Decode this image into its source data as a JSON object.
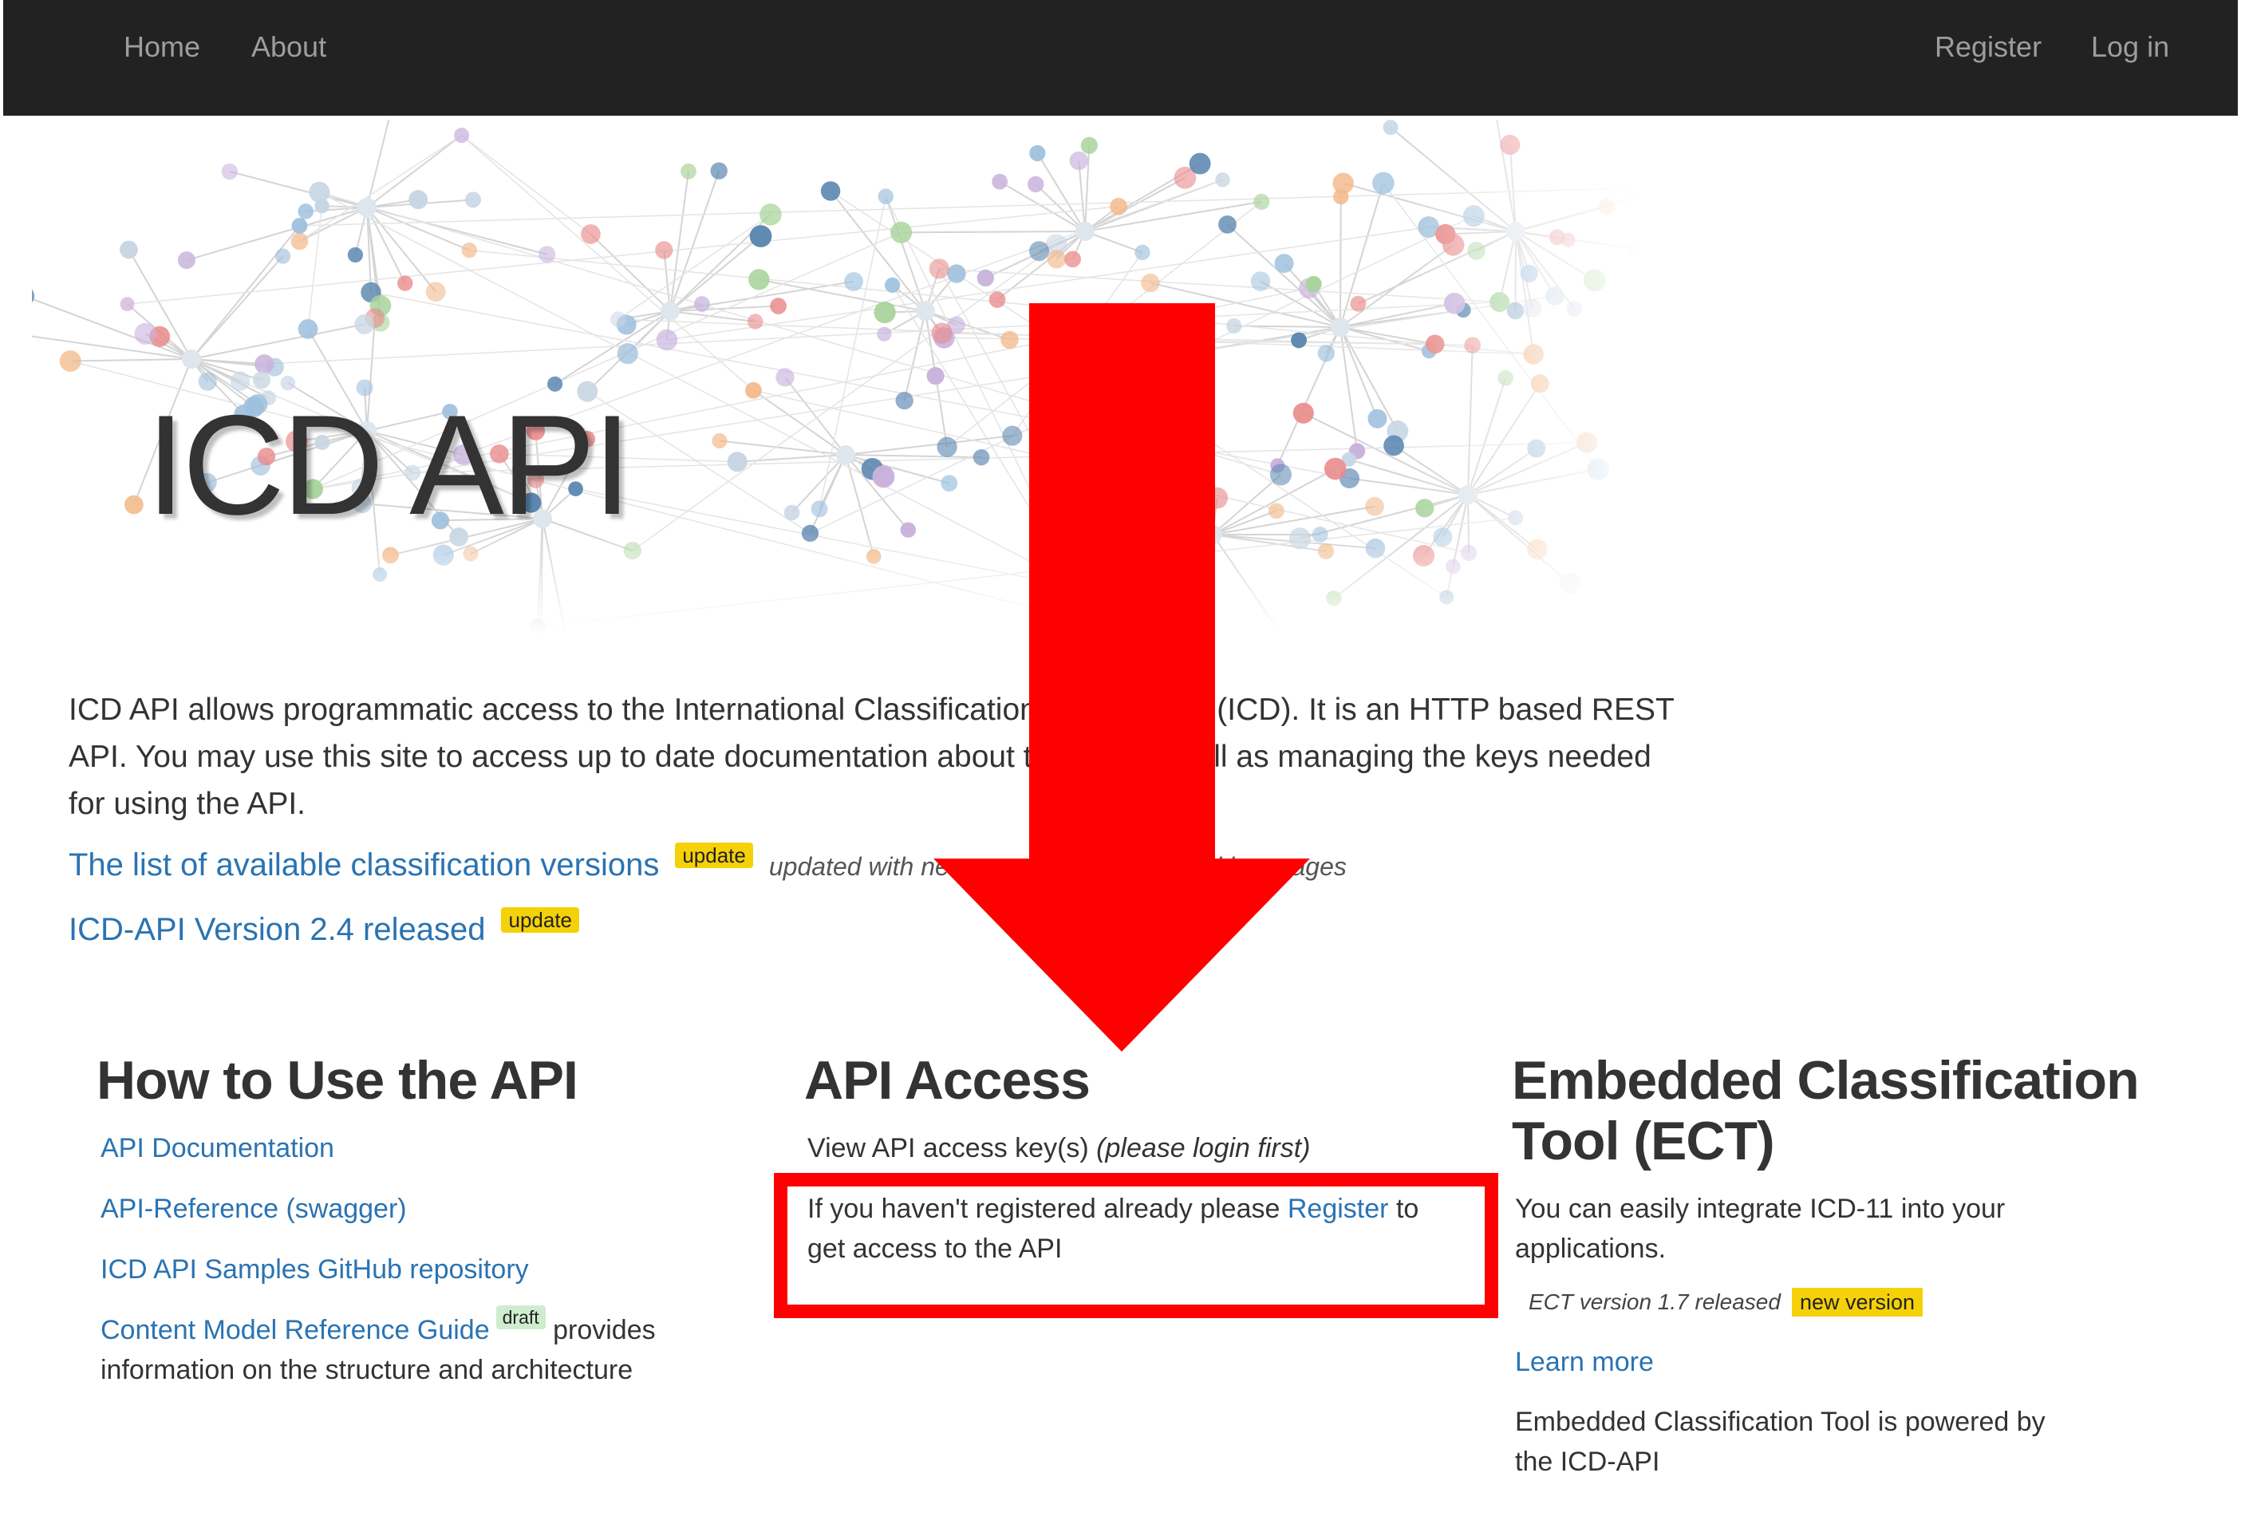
{
  "nav": {
    "home": "Home",
    "about": "About",
    "register": "Register",
    "login": "Log in"
  },
  "hero": {
    "title": "ICD API"
  },
  "intro": {
    "text": "ICD API allows programmatic access to the International Classification of Diseases (ICD). It is an HTTP based REST API. You may use this site to access up to date documentation about the API as well as managing the keys needed for using the API."
  },
  "news": [
    {
      "link": "The list of available classification versions",
      "badge": "update",
      "note": "updated with new translations in several languages"
    },
    {
      "link": "ICD-API Version 2.4 released",
      "badge": "update"
    }
  ],
  "how_to": {
    "title": "How to Use the API",
    "links": [
      "API Documentation",
      "API-Reference (swagger)",
      "ICD API Samples GitHub repository"
    ],
    "guide_link": "Content Model Reference Guide",
    "guide_badge": "draft",
    "guide_text_1": "provides",
    "guide_text_2": "information on the structure and architecture"
  },
  "api_access": {
    "title": "API Access",
    "view_keys": "View API access key(s)",
    "view_keys_note": "(please login first)",
    "register_pre": "If you haven't registered already please",
    "register_link": "Register",
    "register_post": "to",
    "register_line2": "get access to the API"
  },
  "ect": {
    "title_line1": "Embedded Classification",
    "title_line2": "Tool (ECT)",
    "desc_line1": "You can easily integrate ICD-11 into your",
    "desc_line2": "applications.",
    "version_note": "ECT version 1.7 released",
    "version_badge": "new version",
    "learn_more": "Learn more",
    "powered_line1": "Embedded Classification Tool is powered by",
    "powered_line2": "the ICD-API"
  },
  "colors": {
    "navbar": "#222222",
    "link": "#2a73b2",
    "badge_update": "#f5d10a",
    "badge_draft": "#cfeccf",
    "annotation": "#ff0000"
  }
}
